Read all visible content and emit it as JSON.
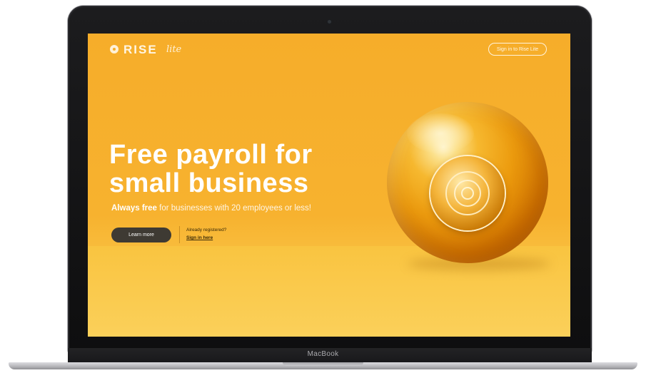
{
  "device": {
    "brand_label": "MacBook"
  },
  "header": {
    "logo_text": "RISE",
    "logo_sub": "lite",
    "signin_button": "Sign in to Rise Lite"
  },
  "hero": {
    "headline_line1": "Free payroll for",
    "headline_line2": "small business",
    "tagline_bold": "Always free",
    "tagline_rest": " for businesses with 20 employees or less!",
    "learn_more": "Learn more",
    "already_registered": "Already registered?",
    "sign_in_here": "Sign in here"
  },
  "colors": {
    "background": "#f7b22f",
    "floor": "#fbd05a",
    "button_dark": "#3e3a33",
    "text_light": "#ffffff"
  },
  "icons": [
    "rise-logo-ring-icon",
    "gold-sphere-illustration"
  ]
}
